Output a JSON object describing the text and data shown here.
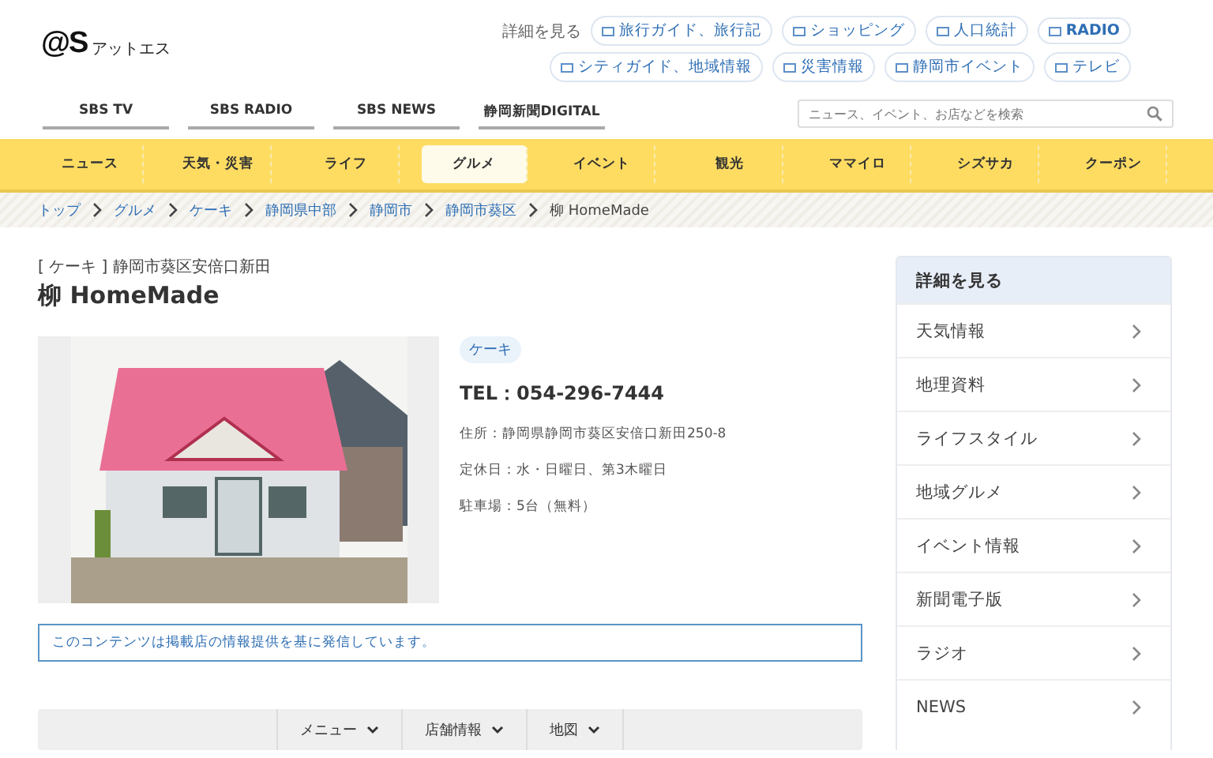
{
  "logo": {
    "mark": "@S",
    "text": "アットエス"
  },
  "header_links": {
    "label": "詳細を見る",
    "items": [
      "旅行ガイド、旅行記",
      "ショッピング",
      "人口統計",
      "RADIO",
      "シティガイド、地域情報",
      "災害情報",
      "静岡市イベント",
      "テレビ"
    ]
  },
  "media_tabs": [
    "SBS TV",
    "SBS RADIO",
    "SBS NEWS",
    "静岡新聞DIGITAL"
  ],
  "search": {
    "placeholder": "ニュース、イベント、お店などを検索"
  },
  "nav": [
    {
      "label": "ニュース",
      "selected": false
    },
    {
      "label": "天気・災害",
      "selected": false
    },
    {
      "label": "ライフ",
      "selected": false
    },
    {
      "label": "グルメ",
      "selected": true
    },
    {
      "label": "イベント",
      "selected": false
    },
    {
      "label": "観光",
      "selected": false
    },
    {
      "label": "ママイロ",
      "selected": false
    },
    {
      "label": "シズサカ",
      "selected": false
    },
    {
      "label": "クーポン",
      "selected": false
    }
  ],
  "breadcrumb": [
    "トップ",
    "グルメ",
    "ケーキ",
    "静岡県中部",
    "静岡市",
    "静岡市葵区",
    "柳 HomeMade"
  ],
  "shop": {
    "category_line": "[ ケーキ ] 静岡市葵区安倍口新田",
    "name": "柳 HomeMade",
    "tag": "ケーキ",
    "tel": "TEL：054-296-7444",
    "details": [
      "住所：静岡県静岡市葵区安倍口新田250-8",
      "定休日：水・日曜日、第3木曜日",
      "駐車場：5台（無料）"
    ],
    "notice": "このコンテンツは掲載店の情報提供を基に発信しています。"
  },
  "section_tabs": [
    "メニュー",
    "店舗情報",
    "地図"
  ],
  "sidebar": {
    "title": "詳細を見る",
    "items": [
      "天気情報",
      "地理資料",
      "ライフスタイル",
      "地域グルメ",
      "イベント情報",
      "新聞電子版",
      "ラジオ",
      "NEWS"
    ]
  }
}
